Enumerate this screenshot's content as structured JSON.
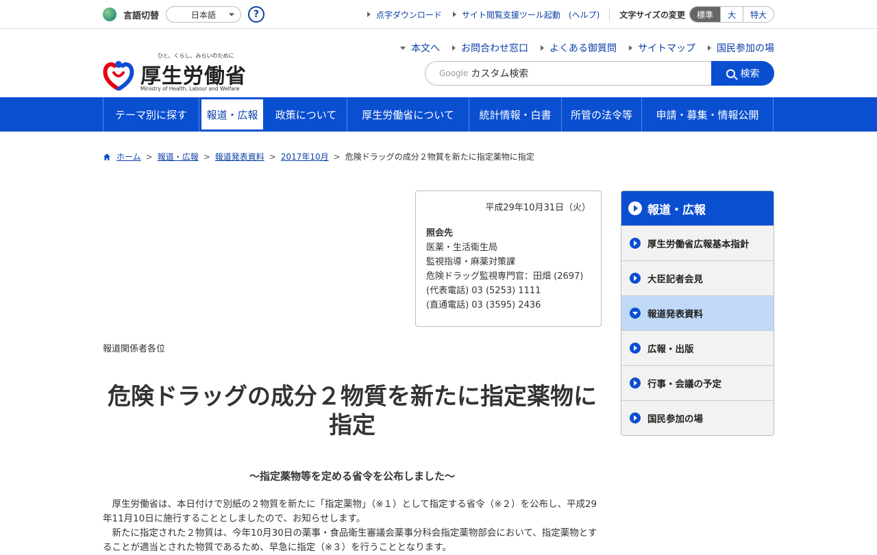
{
  "util": {
    "lang_label": "言語切替",
    "lang_value": "日本語",
    "help": "?",
    "links": [
      "点字ダウンロード",
      "サイト閲覧支援ツール起動　(ヘルプ)"
    ],
    "fontsize_label": "文字サイズの変更",
    "fontsize_options": [
      "標準",
      "大",
      "特大"
    ]
  },
  "logo": {
    "tagline": "ひと、くらし、みらいのために",
    "title": "厚生労働省",
    "en": "Ministry of Health, Labour and Welfare"
  },
  "header_nav": [
    "本文へ",
    "お問合わせ窓口",
    "よくある御質問",
    "サイトマップ",
    "国民参加の場"
  ],
  "search": {
    "google": "Google",
    "placeholder": "カスタム検索",
    "button": "検索"
  },
  "gnav": [
    "テーマ別に探す",
    "報道・広報",
    "政策について",
    "厚生労働省について",
    "統計情報・白書",
    "所管の法令等",
    "申請・募集・情報公開"
  ],
  "breadcrumb": {
    "items": [
      "ホーム",
      "報道・広報",
      "報道発表資料",
      "2017年10月"
    ],
    "current": "危険ドラッグの成分２物質を新たに指定薬物に指定"
  },
  "contact": {
    "date": "平成29年10月31日（火）",
    "label": "照会先",
    "lines": [
      "医薬・生活衛生局",
      "監視指導・麻薬対策課",
      "危険ドラッグ監視専門官：田畑 (2697)",
      "(代表電話) 03 (5253) 1111",
      "(直通電話) 03 (3595) 2436"
    ]
  },
  "addressee": "報道関係者各位",
  "title": "危険ドラッグの成分２物質を新たに指定薬物に指定",
  "subtitle": "～指定薬物等を定める省令を公布しました～",
  "body": [
    "厚生労働省は、本日付けで別紙の２物質を新たに「指定薬物」（※１）として指定する省令（※２）を公布し、平成29年11月10日に施行することとしましたので、お知らせします。",
    "新たに指定された２物質は、今年10月30日の薬事・食品衛生審議会薬事分科会指定薬物部会において、指定薬物とすることが適当とされた物質であるため、早急に指定（※３）を行うこととなります。"
  ],
  "sidebar": {
    "heading": "報道・広報",
    "items": [
      "厚生労働省広報基本指針",
      "大臣記者会見",
      "報道発表資料",
      "広報・出版",
      "行事・会議の予定",
      "国民参加の場"
    ],
    "active_index": 2
  },
  "colors": {
    "brand_blue": "#0b4fd1",
    "link_blue": "#0b3fa8",
    "active_side": "#bfd9f7"
  }
}
